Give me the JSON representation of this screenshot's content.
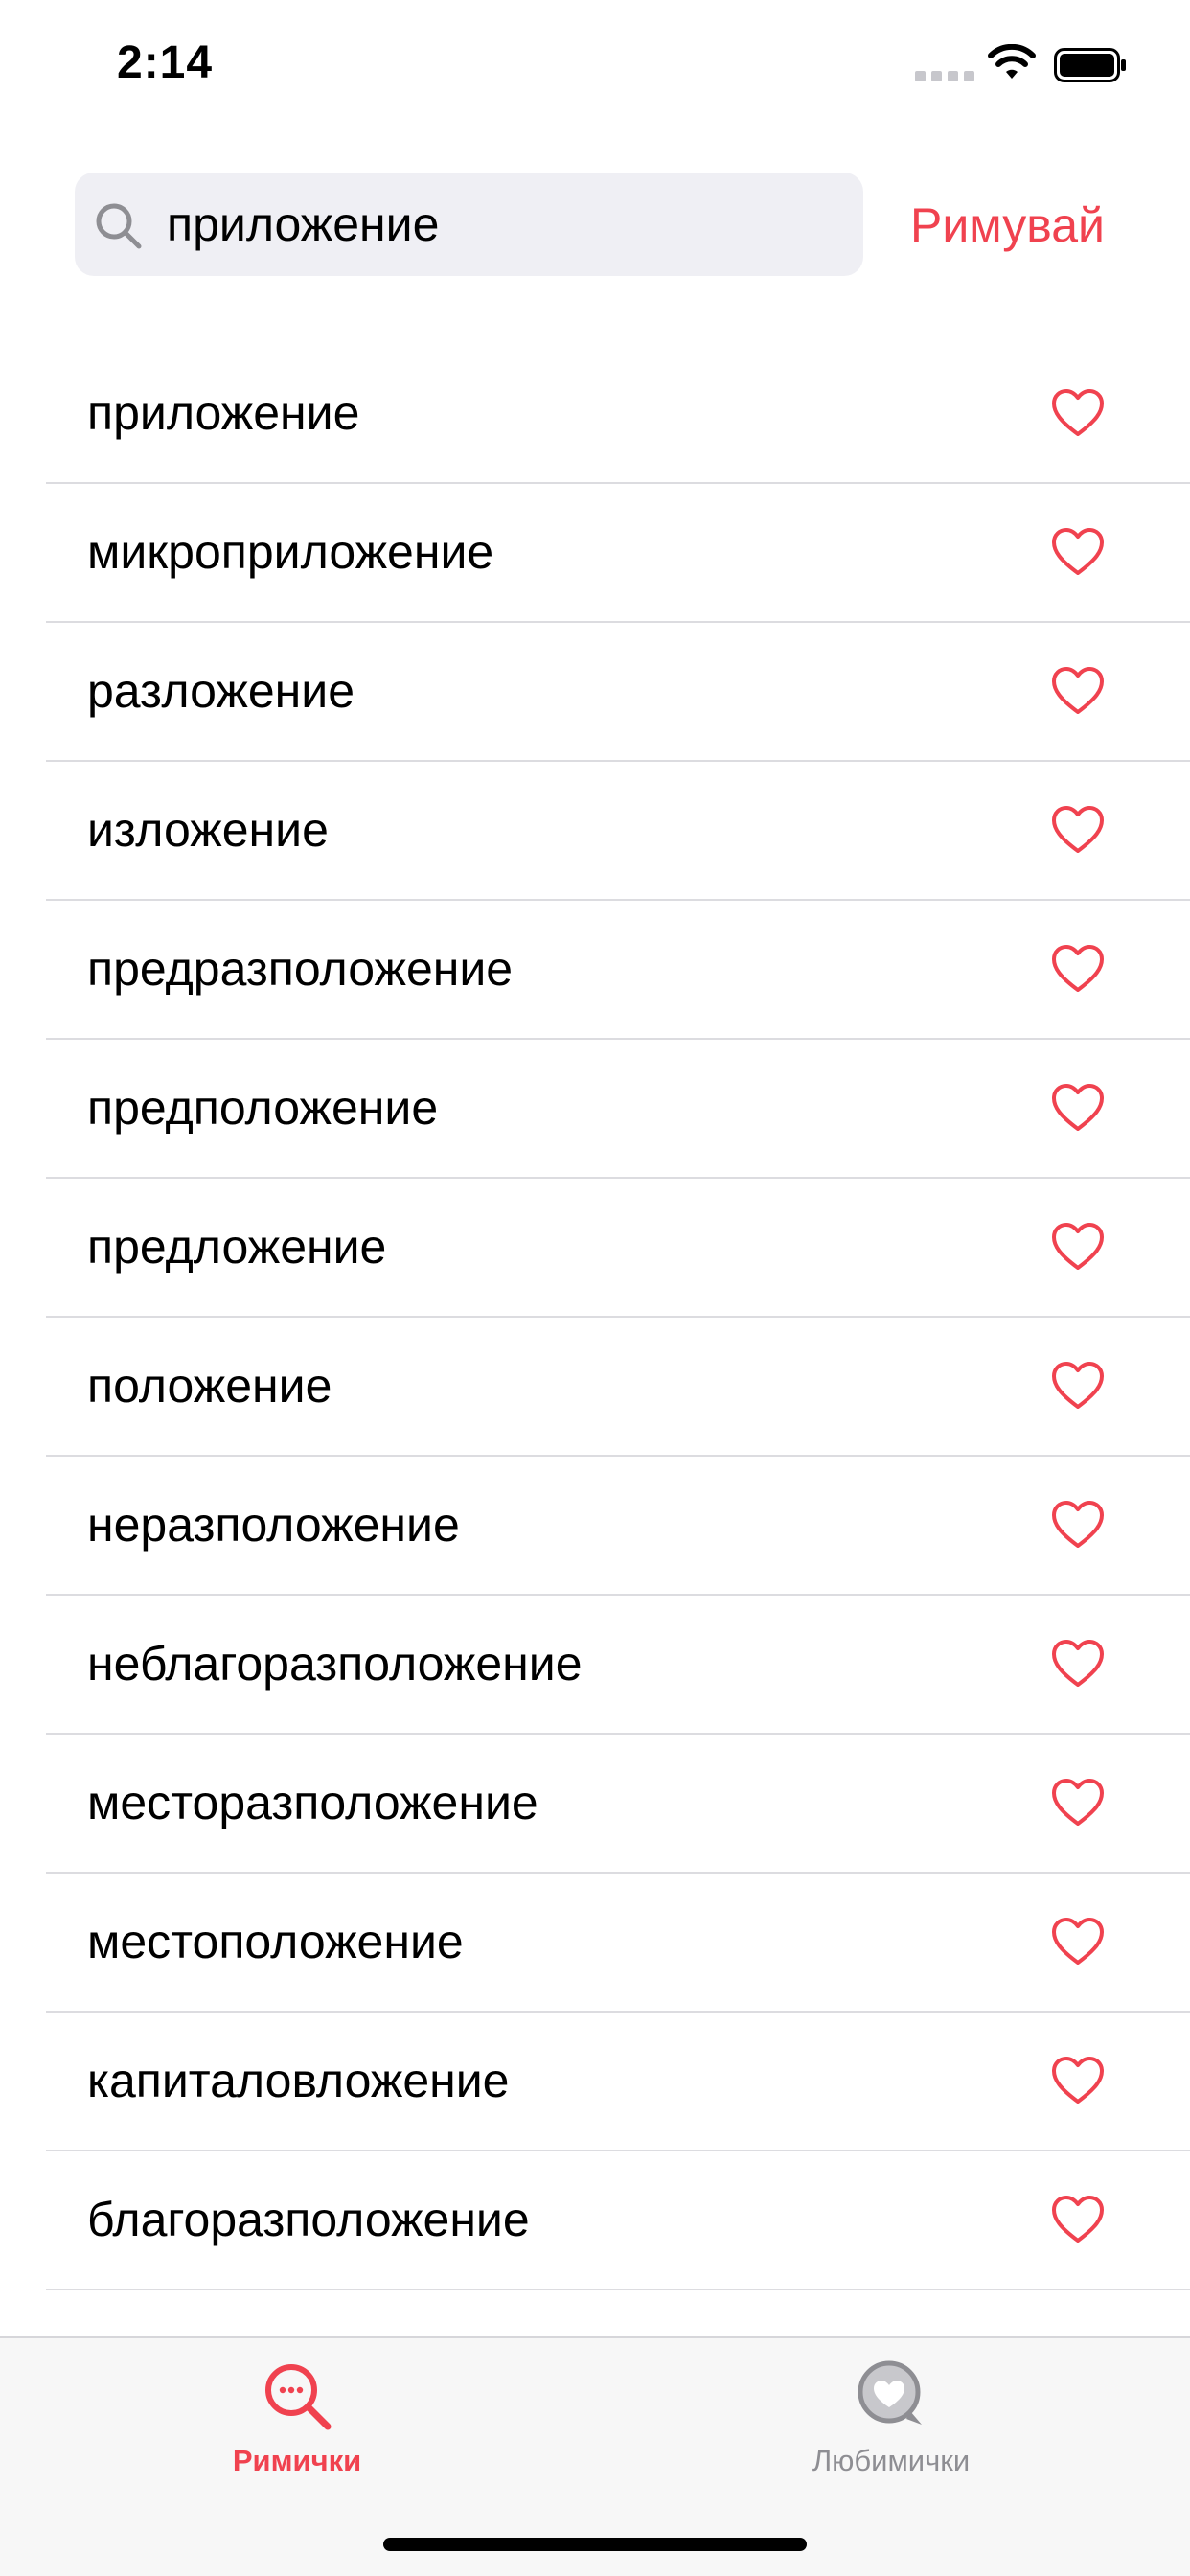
{
  "status_bar": {
    "time": "2:14"
  },
  "colors": {
    "accent": "#f0424f",
    "inactive": "#8e8e93",
    "search_background": "#efeff4",
    "separator": "#dcdce0"
  },
  "search": {
    "value": "приложение",
    "icon": "search-icon",
    "button_label": "Римувай"
  },
  "results": [
    {
      "word": "приложение",
      "favorite": false
    },
    {
      "word": "микроприложение",
      "favorite": false
    },
    {
      "word": "разложение",
      "favorite": false
    },
    {
      "word": "изложение",
      "favorite": false
    },
    {
      "word": "предразположение",
      "favorite": false
    },
    {
      "word": "предположение",
      "favorite": false
    },
    {
      "word": "предложение",
      "favorite": false
    },
    {
      "word": "положение",
      "favorite": false
    },
    {
      "word": "неразположение",
      "favorite": false
    },
    {
      "word": "неблагоразположение",
      "favorite": false
    },
    {
      "word": "месторазположение",
      "favorite": false
    },
    {
      "word": "местоположение",
      "favorite": false
    },
    {
      "word": "капиталовложение",
      "favorite": false
    },
    {
      "word": "благоразположение",
      "favorite": false
    }
  ],
  "tab_bar": {
    "tabs": [
      {
        "label": "Римички",
        "icon": "rhymes-search-icon",
        "selected": true
      },
      {
        "label": "Любимички",
        "icon": "favorites-heart-icon",
        "selected": false
      }
    ]
  }
}
